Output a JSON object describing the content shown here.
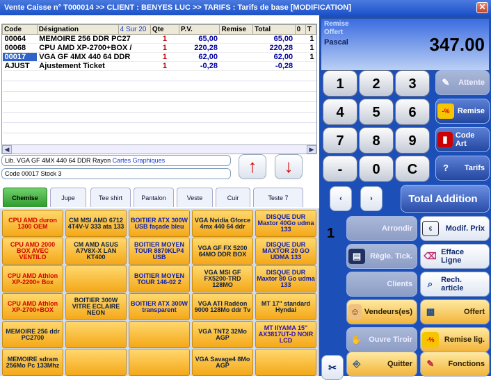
{
  "window": {
    "title": "Vente Caisse n° T000014 >> CLIENT : BENYES LUC  >> TARIFS : Tarifs de base   [MODIFICATION]",
    "close": "✕"
  },
  "grid": {
    "headers": [
      "Code",
      "Désignation",
      "4 Sur 20",
      "Qte",
      "P.V.",
      "Remise",
      "Total",
      "0",
      "T"
    ],
    "rows": [
      {
        "code": "00064",
        "designation": "MEMOIRE 256 DDR PC27",
        "qte": "1",
        "pv": "65,00",
        "remise": "",
        "total": "65,00",
        "t": "1"
      },
      {
        "code": "00068",
        "designation": "CPU AMD XP-2700+BOX /",
        "qte": "1",
        "pv": "220,28",
        "remise": "",
        "total": "220,28",
        "t": "1"
      },
      {
        "code": "00017",
        "designation": "VGA GF 4MX 440 64 DDR",
        "qte": "1",
        "pv": "62,00",
        "remise": "",
        "total": "62,00",
        "t": "1"
      },
      {
        "code": "AJUST",
        "designation": "Ajustement Ticket",
        "qte": "1",
        "pv": "-0,28",
        "remise": "",
        "total": "-0,28",
        "t": ""
      }
    ]
  },
  "info": {
    "lib_prefix": "Lib. VGA GF 4MX 440 64 DDR Rayon",
    "lib_rayon": "Cartes Graphiques",
    "code_stock": "Code 00017 Stock 3"
  },
  "arrows": {
    "up": "↑",
    "down": "↓"
  },
  "tabs": [
    "Chemise",
    "Jupe",
    "Tee shirt",
    "Pantalon",
    "Veste",
    "Cuir",
    "Teste 7"
  ],
  "products": [
    [
      "CPU AMD duron 1300 OEM",
      "CM MSI AMD 6712 4T4V-V 333 ata 133",
      "BOITIER ATX 300W USB façade bleu",
      "VGA Nvidia Gforce 4mx 440 64 ddr",
      "DISQUE DUR Maxtor 40Go udma 133"
    ],
    [
      "CPU AMD 2000 BOX AVEC VENTILO",
      "CM AMD ASUS A7V8X-X LAN KT400",
      "BOITIER MOYEN TOUR 8870KLP4 USB",
      "VGA GF FX 5200 64MO DDR BOX",
      "DISQUE DUR MAXTOR 20 GO UDMA 133"
    ],
    [
      "CPU AMD Athlon XP-2200+ Box",
      "",
      "BOITIER MOYEN TOUR 146-02 2",
      "VGA MSI GF FX5200-TRD 128MO",
      "DISQUE DUR Maxtor 80 Go udma 133"
    ],
    [
      "CPU AMD Athlon XP-2700+BOX",
      "BOITIER 300W VITRE ECLAIRE NEON",
      "BOITIER ATX 300W transparent",
      "VGA ATI Radéon 9000 128Mo ddr Tv",
      "MT 17\" standard Hyndai"
    ],
    [
      "MEMOIRE 256 ddr PC2700",
      "",
      "",
      "VGA TNT2 32Mo AGP",
      "MT IIYAMA 15\" AX3817UT-D NOIR LCD"
    ],
    [
      "MEMOIRE sdram 256Mo Pc 133Mhz",
      "",
      "",
      "VGA Savage4 8Mo AGP",
      ""
    ]
  ],
  "display": {
    "remise_label": "Remise",
    "offert_label": "Offert",
    "vendeur": "Pascal",
    "total": "347.00"
  },
  "keypad": {
    "keys": [
      "1",
      "2",
      "3",
      "4",
      "5",
      "6",
      "7",
      "8",
      "9",
      "-",
      "0",
      "C"
    ]
  },
  "functions": {
    "attente": "Attente",
    "remise": "Remise",
    "code_art": "Code Art",
    "tarifs": "Tarifs",
    "total_addition": "Total Addition",
    "qty": "1",
    "arrondir": "Arrondir",
    "modif_prix": "Modif. Prix",
    "regle_tick": "Règle. Tick.",
    "efface_ligne": "Efface Ligne",
    "clients": "Clients",
    "rech_article": "Rech. article",
    "vendeurs": "Vendeurs(es)",
    "offert": "Offert",
    "ouvre_tiroir": "Ouvre Tiroir",
    "remise_lig": "Remise lig.",
    "quitter": "Quitter",
    "fonctions": "Fonctions",
    "nav_prev": "‹",
    "nav_next": "›"
  }
}
